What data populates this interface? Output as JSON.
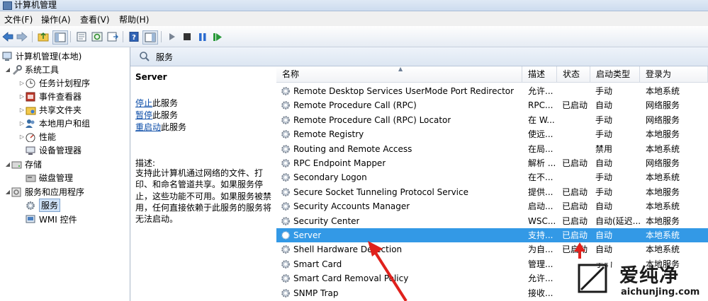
{
  "window": {
    "title": "计算机管理"
  },
  "menu": [
    "文件(F)",
    "操作(A)",
    "查看(V)",
    "帮助(H)"
  ],
  "tree": {
    "root": "计算机管理(本地)",
    "system_tools": "系统工具",
    "task_scheduler": "任务计划程序",
    "event_viewer": "事件查看器",
    "shared_folders": "共享文件夹",
    "local_users": "本地用户和组",
    "performance": "性能",
    "device_manager": "设备管理器",
    "storage": "存储",
    "disk_management": "磁盘管理",
    "services_apps": "服务和应用程序",
    "services": "服务",
    "wmi": "WMI 控件"
  },
  "header": {
    "title": "服务"
  },
  "detail": {
    "service_name": "Server",
    "stop_link": "停止",
    "stop_suffix": "此服务",
    "pause_link": "暂停",
    "pause_suffix": "此服务",
    "restart_link": "重启动",
    "restart_suffix": "此服务",
    "desc_label": "描述:",
    "desc_text": "支持此计算机通过网络的文件、打印、和命名管道共享。如果服务停止，这些功能不可用。如果服务被禁用，任何直接依赖于此服务的服务将无法启动。"
  },
  "columns": {
    "name": "名称",
    "desc": "描述",
    "status": "状态",
    "startup": "启动类型",
    "logon": "登录为"
  },
  "services": [
    {
      "name": "Remote Desktop Services UserMode Port Redirector",
      "desc": "允许...",
      "status": "",
      "startup": "手动",
      "logon": "本地系统"
    },
    {
      "name": "Remote Procedure Call (RPC)",
      "desc": "RPC...",
      "status": "已启动",
      "startup": "自动",
      "logon": "网络服务"
    },
    {
      "name": "Remote Procedure Call (RPC) Locator",
      "desc": "在 W...",
      "status": "",
      "startup": "手动",
      "logon": "网络服务"
    },
    {
      "name": "Remote Registry",
      "desc": "使远...",
      "status": "",
      "startup": "手动",
      "logon": "本地服务"
    },
    {
      "name": "Routing and Remote Access",
      "desc": "在局...",
      "status": "",
      "startup": "禁用",
      "logon": "本地系统"
    },
    {
      "name": "RPC Endpoint Mapper",
      "desc": "解析 ...",
      "status": "已启动",
      "startup": "自动",
      "logon": "网络服务"
    },
    {
      "name": "Secondary Logon",
      "desc": "在不...",
      "status": "",
      "startup": "手动",
      "logon": "本地系统"
    },
    {
      "name": "Secure Socket Tunneling Protocol Service",
      "desc": "提供...",
      "status": "已启动",
      "startup": "手动",
      "logon": "本地服务"
    },
    {
      "name": "Security Accounts Manager",
      "desc": "启动...",
      "status": "已启动",
      "startup": "自动",
      "logon": "本地系统"
    },
    {
      "name": "Security Center",
      "desc": "WSC...",
      "status": "已启动",
      "startup": "自动(延迟...",
      "logon": "本地服务"
    },
    {
      "name": "Server",
      "desc": "支持...",
      "status": "已启动",
      "startup": "自动",
      "logon": "本地系统",
      "selected": true
    },
    {
      "name": "Shell Hardware Detection",
      "desc": "为自...",
      "status": "已启动",
      "startup": "自动",
      "logon": "本地系统"
    },
    {
      "name": "Smart Card",
      "desc": "管理...",
      "status": "",
      "startup": "手动",
      "logon": "本地服务"
    },
    {
      "name": "Smart Card Removal Policy",
      "desc": "允许...",
      "status": "",
      "startup": "",
      "logon": ""
    },
    {
      "name": "SNMP Trap",
      "desc": "接收...",
      "status": "",
      "startup": "",
      "logon": ""
    }
  ],
  "watermark": {
    "brand": "爱纯净",
    "url": "aichunjing.com"
  },
  "colors": {
    "selection": "#3399e6",
    "link": "#0b4ca8",
    "annotation": "#e0211c"
  }
}
